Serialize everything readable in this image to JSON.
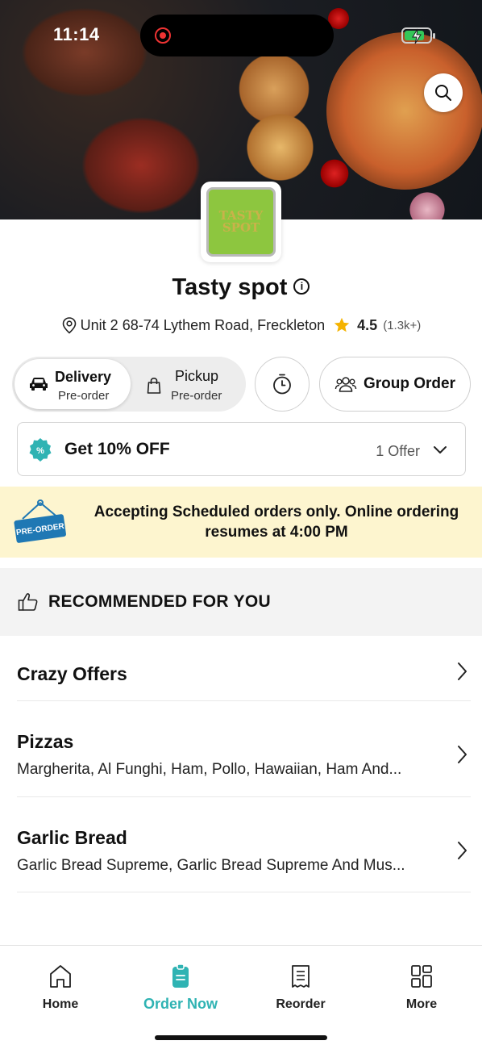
{
  "status_bar": {
    "time": "11:14"
  },
  "store": {
    "name": "Tasty spot",
    "logo_text": "TASTY SPOT",
    "address": "Unit 2 68-74 Lythem Road, Freckleton",
    "rating": "4.5",
    "rating_count": "(1.3k+)"
  },
  "order_modes": {
    "delivery_label": "Delivery",
    "delivery_sub": "Pre-order",
    "pickup_label": "Pickup",
    "pickup_sub": "Pre-order",
    "group_order_label": "Group Order",
    "selected": "Delivery"
  },
  "offer": {
    "title": "Get 10% OFF",
    "count": "1 Offer"
  },
  "banner": {
    "sign_text": "PRE-ORDER",
    "message": "Accepting Scheduled orders only. Online ordering resumes at 4:00 PM"
  },
  "recommended": {
    "title": "RECOMMENDED FOR YOU"
  },
  "categories": [
    {
      "name": "Crazy Offers",
      "desc": ""
    },
    {
      "name": "Pizzas",
      "desc": "Margherita, Al Funghi, Ham, Pollo, Hawaiian, Ham And..."
    },
    {
      "name": "Garlic Bread",
      "desc": "Garlic Bread Supreme, Garlic Bread Supreme And Mus..."
    }
  ],
  "tabs": [
    {
      "label": "Home",
      "icon": "home-icon"
    },
    {
      "label": "Order Now",
      "icon": "order-now-icon",
      "active": true
    },
    {
      "label": "Reorder",
      "icon": "receipt-icon"
    },
    {
      "label": "More",
      "icon": "grid-icon"
    }
  ],
  "colors": {
    "accent": "#2fb3b3",
    "banner_bg": "#fdf5cf",
    "logo_bg": "#8dc63f",
    "star": "#f5b301"
  }
}
